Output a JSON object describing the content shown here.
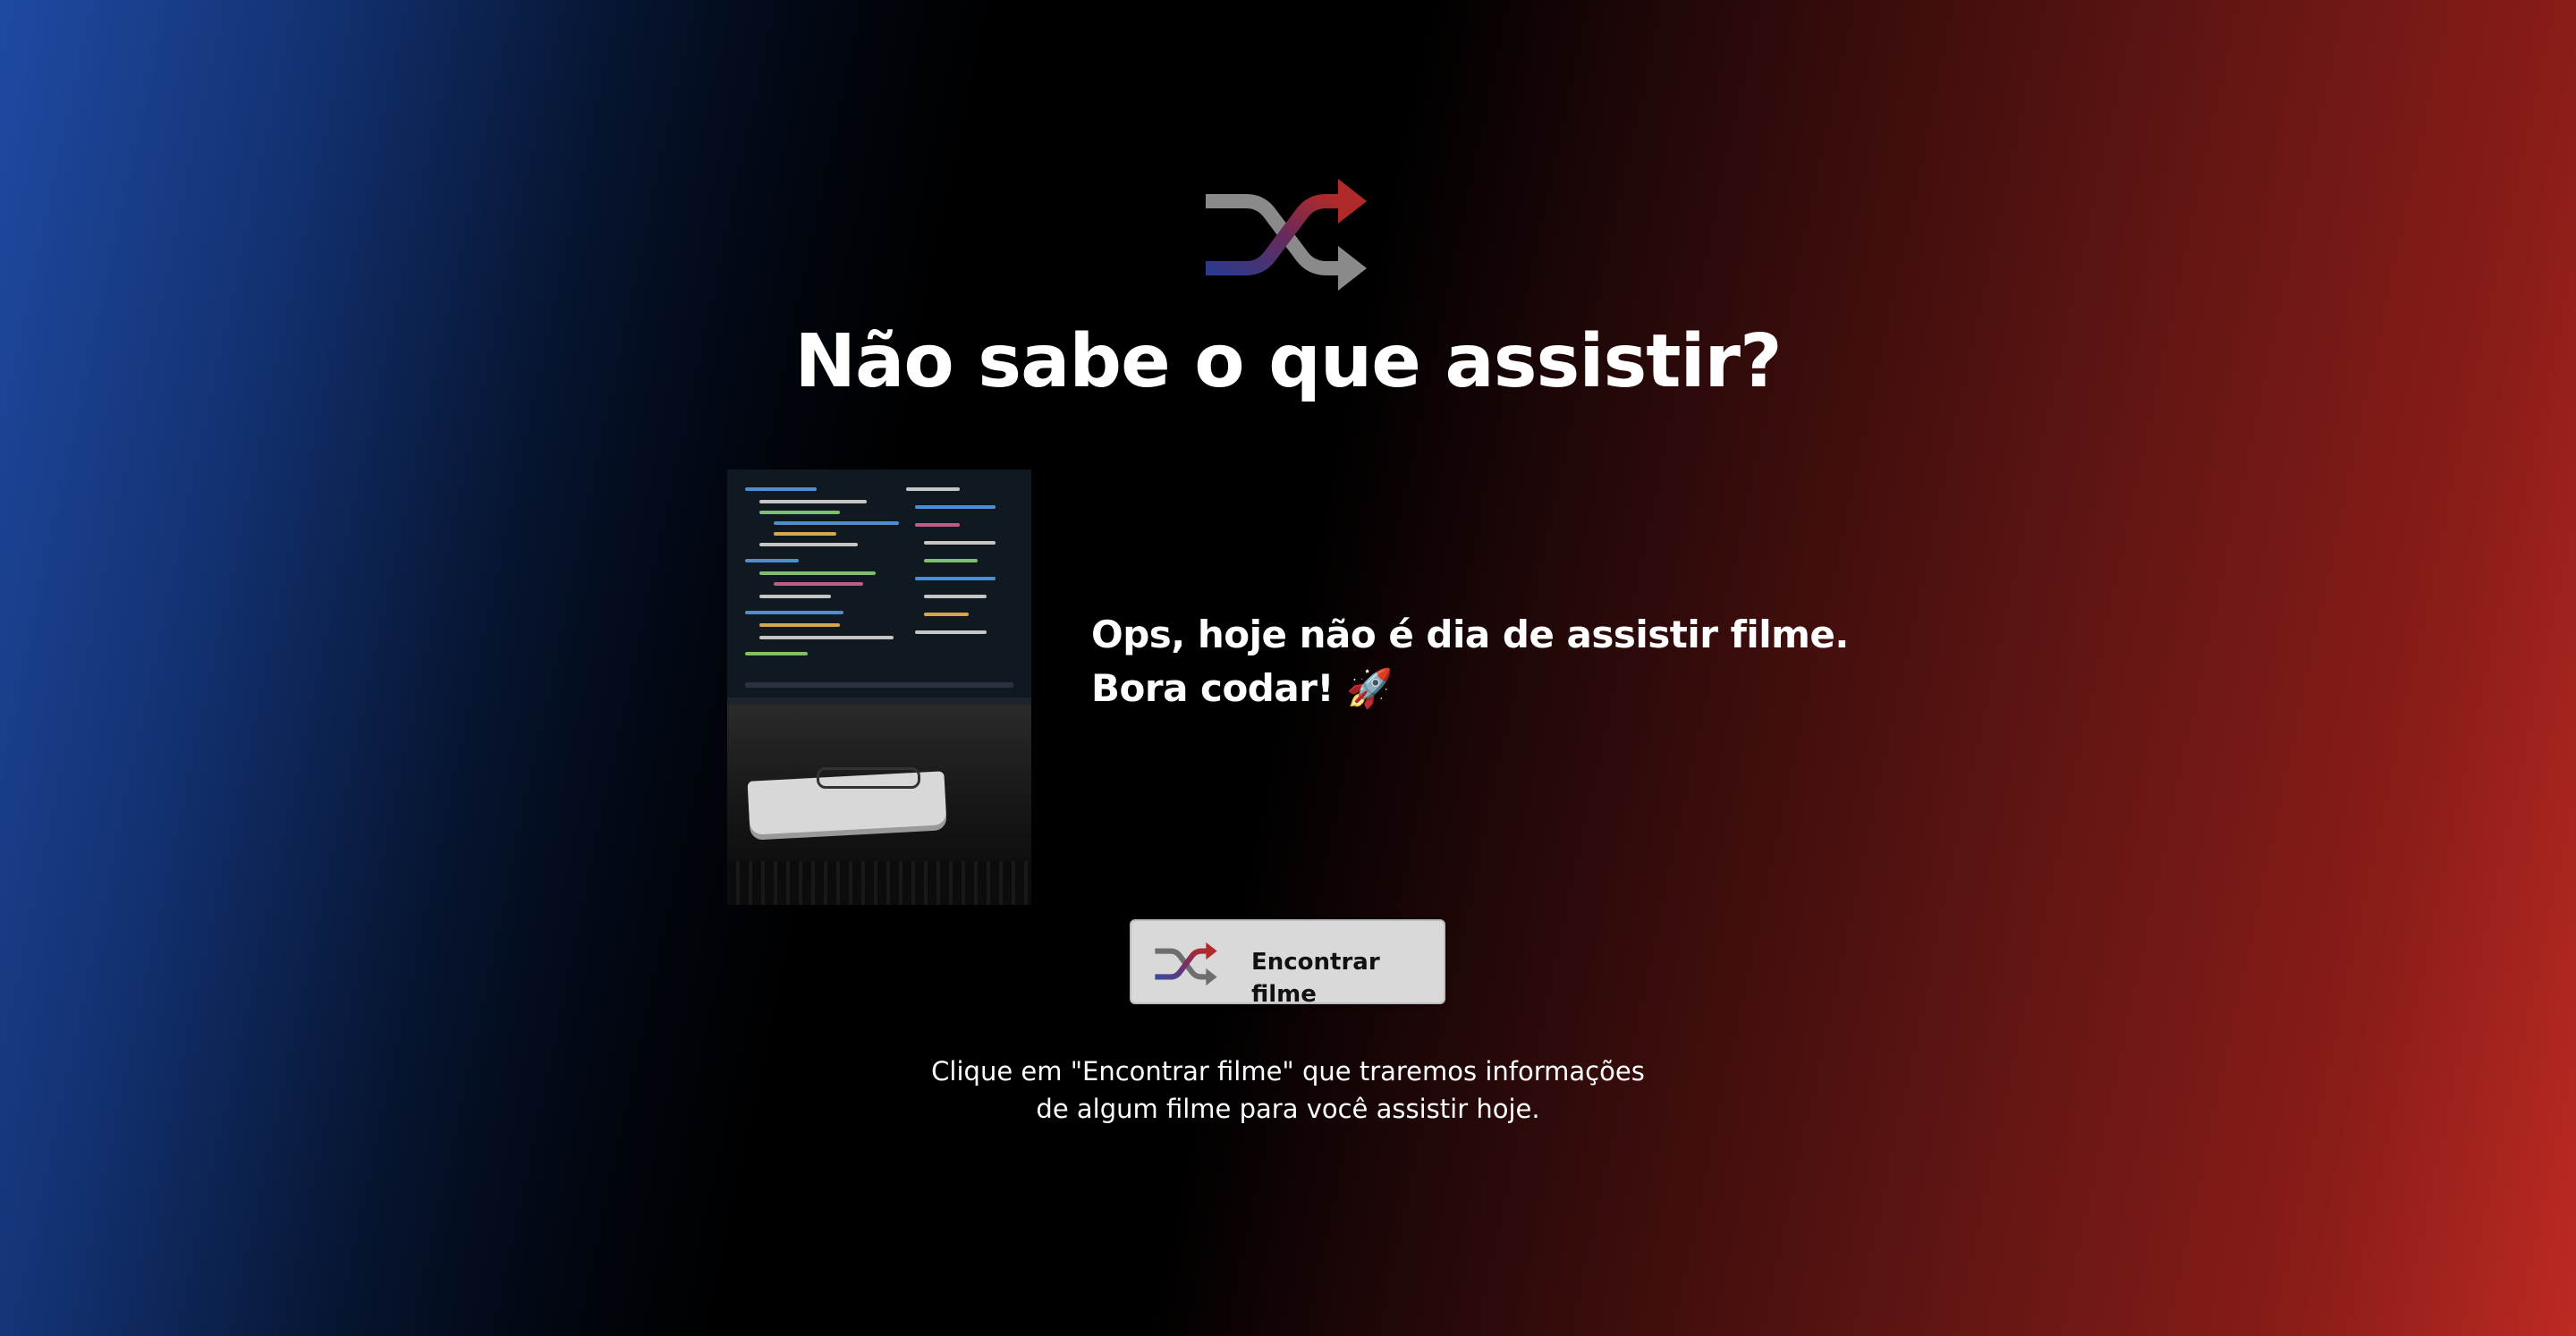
{
  "header": {
    "logo_icon": "shuffle-icon",
    "title": "Não sabe o que assistir?"
  },
  "movie": {
    "poster_alt": "",
    "poster_icon": "workspace-photo",
    "description": "Ops, hoje não é dia de assistir filme. Bora codar! 🚀"
  },
  "actions": {
    "find_button_label": "Encontrar filme",
    "find_button_icon": "shuffle-icon"
  },
  "footer": {
    "hint_line1": "Clique em \"Encontrar filme\" que traremos informações",
    "hint_line2": "de algum filme para você assistir hoje."
  },
  "colors": {
    "gradient_left": "#1f4aa3",
    "gradient_center": "#000000",
    "gradient_right": "#bd2a22",
    "button_bg": "#d9d9d9",
    "text": "#ffffff"
  }
}
